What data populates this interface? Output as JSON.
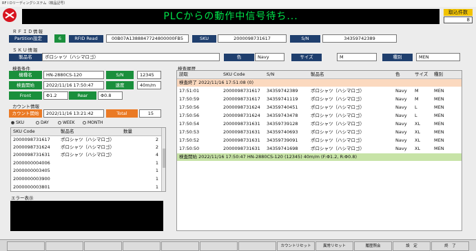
{
  "window_title": "RF I Dリーディングシステム（検品記号）",
  "banner_text": "PLCからの動作中信号待ち...",
  "count": {
    "label": "取込件数",
    "value": "8"
  },
  "rfid": {
    "section_title": "ＲＦＩＤ情報",
    "partition_label": "Partition設定",
    "partition_value": "6",
    "rfid_read_label": "RFID Read",
    "rfid_read_value": "00B07A1388847724800000FB5",
    "sku_label": "SKU",
    "sku_value": "2000098731617",
    "sn_label": "S/N",
    "sn_value": "34359742389"
  },
  "sku_info": {
    "section_title": "ＳＫＵ情報",
    "product_label": "製品名",
    "product_value": "ポロシャツ（ハシマロゴ）",
    "color_label": "色",
    "color_value": "Navy",
    "size_label": "サイズ",
    "size_value": "M",
    "type_label": "種別",
    "type_value": "MEN"
  },
  "inspection": {
    "section_title": "検査条件",
    "machine_label": "機種名",
    "machine_value": "HN-2880CS-120",
    "sn_label": "S/N",
    "sn_value": "12345",
    "start_label": "検査開始",
    "start_value": "2022/11/16 17:50:47",
    "speed_label": "速度",
    "speed_value": "40m/m",
    "front_label": "Front",
    "front_value": "Φ1.2",
    "rear_label": "Rear",
    "rear_value": "Φ0.8"
  },
  "count_info": {
    "section_title": "カウント情報",
    "start_label": "カウント開始",
    "start_value": "2022/11/16 13:21:42",
    "total_label": "Total",
    "total_value": "15",
    "radios": [
      {
        "label": "SKU",
        "selected": true
      },
      {
        "label": "DAY",
        "selected": false
      },
      {
        "label": "WEEK",
        "selected": false
      },
      {
        "label": "MONTH",
        "selected": false
      }
    ],
    "columns": [
      "SKU Code",
      "製品名",
      "数量"
    ],
    "rows": [
      [
        "2000098731617",
        "ポロシャツ（ハシマロゴ）",
        "2"
      ],
      [
        "2000098731624",
        "ポロシャツ（ハシマロゴ）",
        "2"
      ],
      [
        "2000098731631",
        "ポロシャツ（ハシマロゴ）",
        "4"
      ],
      [
        "2000000004006",
        "",
        "1"
      ],
      [
        "2000000003405",
        "",
        "1"
      ],
      [
        "2000000003900",
        "",
        "1"
      ],
      [
        "2000000003801",
        "",
        "1"
      ]
    ]
  },
  "error": {
    "section_title": "エラー表示"
  },
  "history": {
    "section_title": "検査履歴",
    "columns": [
      "読取",
      "SKU Code",
      "S/N",
      "製品名",
      "色",
      "サイズ",
      "種別"
    ],
    "end_row": "検査終了 2022/11/16 17:51:08 (0)",
    "rows": [
      [
        "17:51:01",
        "2000098731617",
        "34359742389",
        "ポロシャツ（ハシマロゴ）",
        "Navy",
        "M",
        "MEN"
      ],
      [
        "17:50:59",
        "2000098731617",
        "34359741119",
        "ポロシャツ（ハシマロゴ）",
        "Navy",
        "M",
        "MEN"
      ],
      [
        "17:50:56",
        "2000098731624",
        "34359740451",
        "ポロシャツ（ハシマロゴ）",
        "Navy",
        "L",
        "MEN"
      ],
      [
        "17:50:56",
        "2000098731624",
        "34359743478",
        "ポロシャツ（ハシマロゴ）",
        "Navy",
        "L",
        "MEN"
      ],
      [
        "17:50:54",
        "2000098731631",
        "34359739128",
        "ポロシャツ（ハシマロゴ）",
        "Navy",
        "XL",
        "MEN"
      ],
      [
        "17:50:53",
        "2000098731631",
        "34359740693",
        "ポロシャツ（ハシマロゴ）",
        "Navy",
        "XL",
        "MEN"
      ],
      [
        "17:50:52",
        "2000098731631",
        "34359739091",
        "ポロシャツ（ハシマロゴ）",
        "Navy",
        "XL",
        "MEN"
      ],
      [
        "17:50:50",
        "2000098731631",
        "34359741698",
        "ポロシャツ（ハシマロゴ）",
        "Navy",
        "XL",
        "MEN"
      ]
    ],
    "start_row": "検査開始 2022/11/16 17:50:47 HN-2880CS-120 (12345) 40m/m (F:Φ1.2, R:Φ0.8)"
  },
  "buttons": [
    "",
    "",
    "",
    "",
    "",
    "",
    "",
    "カウントリセット",
    "異常リセット",
    "履歴照会",
    "設　定",
    "終　了"
  ],
  "colors": {
    "banner_text": "#00e24a",
    "label_blue": "#1f3f6e",
    "label_green": "#1a8f3c",
    "label_orange": "#ea7a25",
    "end_row_bg": "#fbd9bf",
    "start_row_bg": "#c7e3a7",
    "count_label_bg": "#f2c300"
  }
}
